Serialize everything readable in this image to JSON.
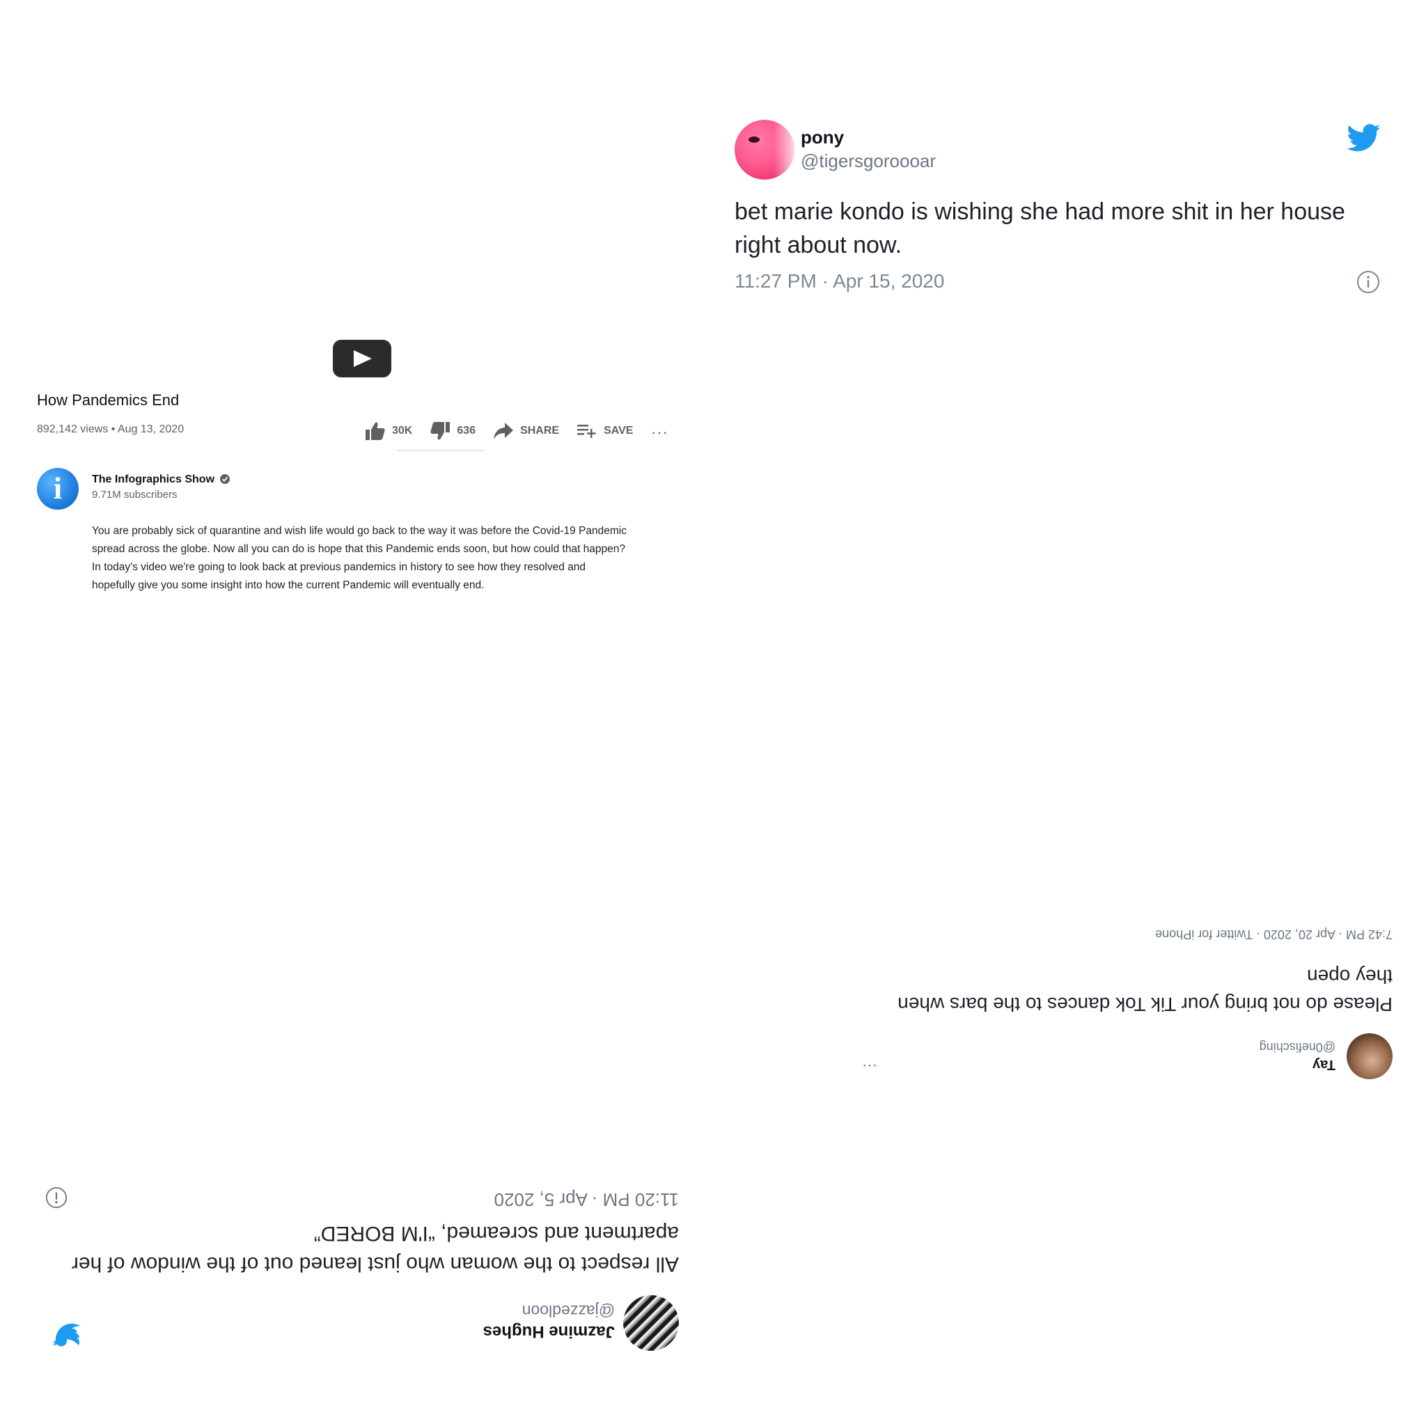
{
  "tweet_top": {
    "name": "pony",
    "handle": "@tigersgoroooar",
    "text": "bet marie kondo is wishing she had more shit in her house right about now.",
    "timestamp": "11:27 PM · Apr 15, 2020",
    "icons": [
      "avatar",
      "twitter-bird-icon",
      "info-icon"
    ],
    "accent_color": "#1d9bf0"
  },
  "youtube": {
    "title": "How Pandemics End",
    "meta": "892,142 views • Aug 13, 2020",
    "like_count": "30K",
    "dislike_count": "636",
    "share_label": "SHARE",
    "save_label": "SAVE",
    "more_label": "···",
    "channel_name": "The Infographics Show",
    "channel_avatar_letter": "i",
    "subscribers": "9.71M subscribers",
    "description": "You are probably sick of quarantine and wish life would go back to the way it was before the Covid-19 Pandemic spread across the globe. Now all you can do is hope that this Pandemic ends soon, but how could that happen? In today's video we're going to look back at previous pandemics in history to see how they resolved and hopefully give you some insight into how the current Pandemic will eventually end.",
    "icons": [
      "play-button-icon",
      "thumbs-up-icon",
      "thumbs-down-icon",
      "share-arrow-icon",
      "playlist-add-icon",
      "more-dots-icon",
      "verified-check-icon"
    ]
  },
  "tweet_mid": {
    "name": "Tay",
    "handle": "@0nefisching",
    "more_label": "···",
    "text": "Please do not bring your Tik Tok dances to the bars when they open",
    "timestamp": "7:42 PM · Apr 20, 2020 · Twitter for iPhone"
  },
  "tweet_bottom": {
    "name": "Jazmine Hughes",
    "handle": "@jazzedloon",
    "text": "All respect to the woman who just leaned out of the window of her apartment and screamed, “I'M BORED”",
    "timestamp": "11:20 PM · Apr 5, 2020",
    "icons": [
      "avatar",
      "twitter-bird-icon",
      "info-icon"
    ]
  }
}
